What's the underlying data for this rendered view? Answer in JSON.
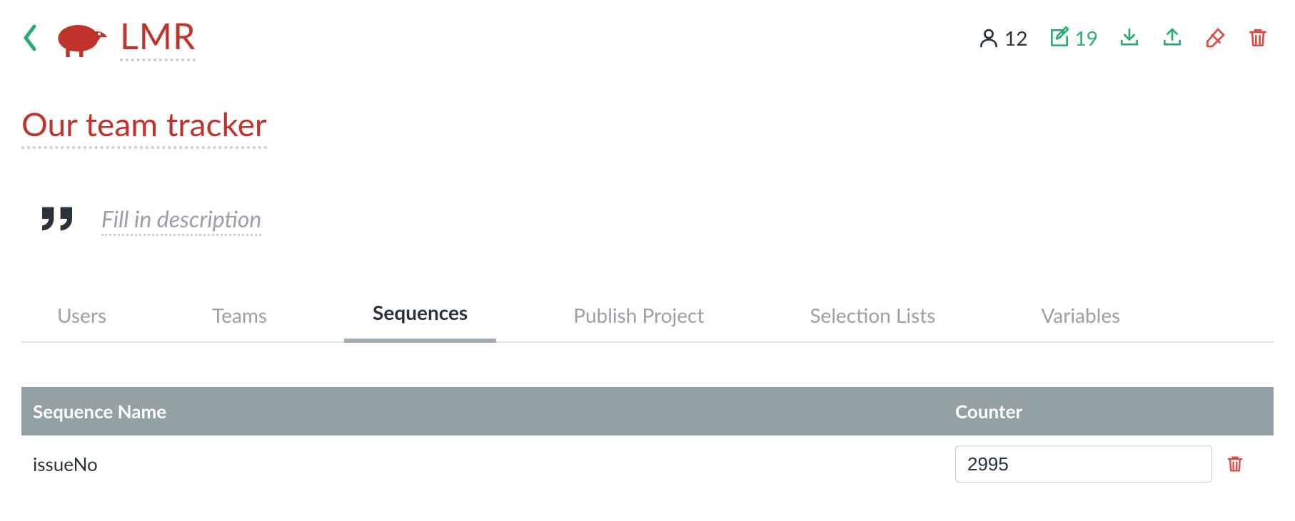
{
  "header": {
    "app_name": "LMR",
    "users_count": "12",
    "edits_count": "19"
  },
  "page": {
    "title": "Our team tracker",
    "description_placeholder": "Fill in description"
  },
  "tabs": [
    {
      "label": "Users",
      "active": false
    },
    {
      "label": "Teams",
      "active": false
    },
    {
      "label": "Sequences",
      "active": true
    },
    {
      "label": "Publish Project",
      "active": false
    },
    {
      "label": "Selection Lists",
      "active": false
    },
    {
      "label": "Variables",
      "active": false
    }
  ],
  "table": {
    "columns": {
      "name": "Sequence Name",
      "counter": "Counter"
    },
    "rows": [
      {
        "name": "issueNo",
        "counter": "2995"
      }
    ]
  }
}
